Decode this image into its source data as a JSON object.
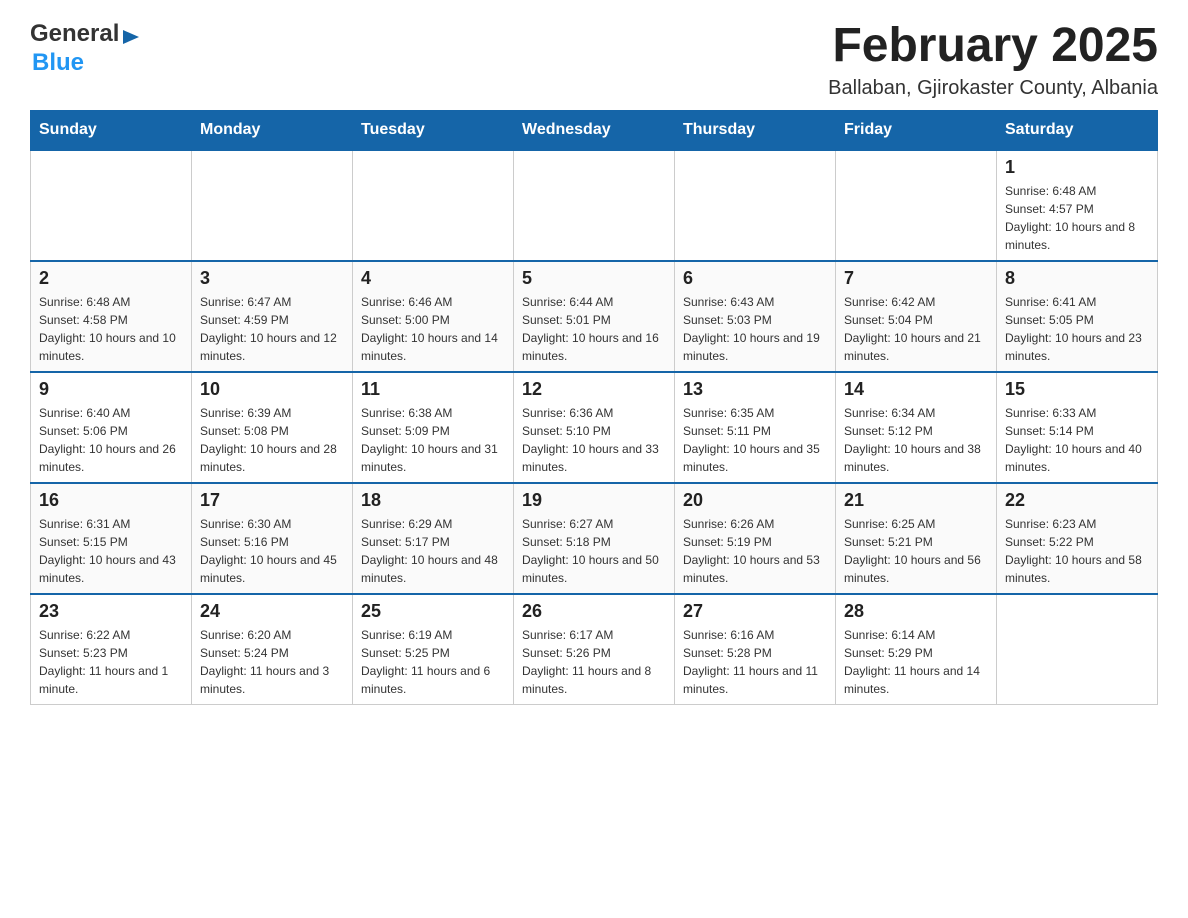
{
  "header": {
    "logo": {
      "general": "General",
      "arrow_symbol": "▶",
      "blue": "Blue"
    },
    "title": "February 2025",
    "location": "Ballaban, Gjirokaster County, Albania"
  },
  "days_of_week": [
    "Sunday",
    "Monday",
    "Tuesday",
    "Wednesday",
    "Thursday",
    "Friday",
    "Saturday"
  ],
  "weeks": [
    {
      "days": [
        {
          "date": "",
          "sunrise": "",
          "sunset": "",
          "daylight": ""
        },
        {
          "date": "",
          "sunrise": "",
          "sunset": "",
          "daylight": ""
        },
        {
          "date": "",
          "sunrise": "",
          "sunset": "",
          "daylight": ""
        },
        {
          "date": "",
          "sunrise": "",
          "sunset": "",
          "daylight": ""
        },
        {
          "date": "",
          "sunrise": "",
          "sunset": "",
          "daylight": ""
        },
        {
          "date": "",
          "sunrise": "",
          "sunset": "",
          "daylight": ""
        },
        {
          "date": "1",
          "sunrise": "Sunrise: 6:48 AM",
          "sunset": "Sunset: 4:57 PM",
          "daylight": "Daylight: 10 hours and 8 minutes."
        }
      ]
    },
    {
      "days": [
        {
          "date": "2",
          "sunrise": "Sunrise: 6:48 AM",
          "sunset": "Sunset: 4:58 PM",
          "daylight": "Daylight: 10 hours and 10 minutes."
        },
        {
          "date": "3",
          "sunrise": "Sunrise: 6:47 AM",
          "sunset": "Sunset: 4:59 PM",
          "daylight": "Daylight: 10 hours and 12 minutes."
        },
        {
          "date": "4",
          "sunrise": "Sunrise: 6:46 AM",
          "sunset": "Sunset: 5:00 PM",
          "daylight": "Daylight: 10 hours and 14 minutes."
        },
        {
          "date": "5",
          "sunrise": "Sunrise: 6:44 AM",
          "sunset": "Sunset: 5:01 PM",
          "daylight": "Daylight: 10 hours and 16 minutes."
        },
        {
          "date": "6",
          "sunrise": "Sunrise: 6:43 AM",
          "sunset": "Sunset: 5:03 PM",
          "daylight": "Daylight: 10 hours and 19 minutes."
        },
        {
          "date": "7",
          "sunrise": "Sunrise: 6:42 AM",
          "sunset": "Sunset: 5:04 PM",
          "daylight": "Daylight: 10 hours and 21 minutes."
        },
        {
          "date": "8",
          "sunrise": "Sunrise: 6:41 AM",
          "sunset": "Sunset: 5:05 PM",
          "daylight": "Daylight: 10 hours and 23 minutes."
        }
      ]
    },
    {
      "days": [
        {
          "date": "9",
          "sunrise": "Sunrise: 6:40 AM",
          "sunset": "Sunset: 5:06 PM",
          "daylight": "Daylight: 10 hours and 26 minutes."
        },
        {
          "date": "10",
          "sunrise": "Sunrise: 6:39 AM",
          "sunset": "Sunset: 5:08 PM",
          "daylight": "Daylight: 10 hours and 28 minutes."
        },
        {
          "date": "11",
          "sunrise": "Sunrise: 6:38 AM",
          "sunset": "Sunset: 5:09 PM",
          "daylight": "Daylight: 10 hours and 31 minutes."
        },
        {
          "date": "12",
          "sunrise": "Sunrise: 6:36 AM",
          "sunset": "Sunset: 5:10 PM",
          "daylight": "Daylight: 10 hours and 33 minutes."
        },
        {
          "date": "13",
          "sunrise": "Sunrise: 6:35 AM",
          "sunset": "Sunset: 5:11 PM",
          "daylight": "Daylight: 10 hours and 35 minutes."
        },
        {
          "date": "14",
          "sunrise": "Sunrise: 6:34 AM",
          "sunset": "Sunset: 5:12 PM",
          "daylight": "Daylight: 10 hours and 38 minutes."
        },
        {
          "date": "15",
          "sunrise": "Sunrise: 6:33 AM",
          "sunset": "Sunset: 5:14 PM",
          "daylight": "Daylight: 10 hours and 40 minutes."
        }
      ]
    },
    {
      "days": [
        {
          "date": "16",
          "sunrise": "Sunrise: 6:31 AM",
          "sunset": "Sunset: 5:15 PM",
          "daylight": "Daylight: 10 hours and 43 minutes."
        },
        {
          "date": "17",
          "sunrise": "Sunrise: 6:30 AM",
          "sunset": "Sunset: 5:16 PM",
          "daylight": "Daylight: 10 hours and 45 minutes."
        },
        {
          "date": "18",
          "sunrise": "Sunrise: 6:29 AM",
          "sunset": "Sunset: 5:17 PM",
          "daylight": "Daylight: 10 hours and 48 minutes."
        },
        {
          "date": "19",
          "sunrise": "Sunrise: 6:27 AM",
          "sunset": "Sunset: 5:18 PM",
          "daylight": "Daylight: 10 hours and 50 minutes."
        },
        {
          "date": "20",
          "sunrise": "Sunrise: 6:26 AM",
          "sunset": "Sunset: 5:19 PM",
          "daylight": "Daylight: 10 hours and 53 minutes."
        },
        {
          "date": "21",
          "sunrise": "Sunrise: 6:25 AM",
          "sunset": "Sunset: 5:21 PM",
          "daylight": "Daylight: 10 hours and 56 minutes."
        },
        {
          "date": "22",
          "sunrise": "Sunrise: 6:23 AM",
          "sunset": "Sunset: 5:22 PM",
          "daylight": "Daylight: 10 hours and 58 minutes."
        }
      ]
    },
    {
      "days": [
        {
          "date": "23",
          "sunrise": "Sunrise: 6:22 AM",
          "sunset": "Sunset: 5:23 PM",
          "daylight": "Daylight: 11 hours and 1 minute."
        },
        {
          "date": "24",
          "sunrise": "Sunrise: 6:20 AM",
          "sunset": "Sunset: 5:24 PM",
          "daylight": "Daylight: 11 hours and 3 minutes."
        },
        {
          "date": "25",
          "sunrise": "Sunrise: 6:19 AM",
          "sunset": "Sunset: 5:25 PM",
          "daylight": "Daylight: 11 hours and 6 minutes."
        },
        {
          "date": "26",
          "sunrise": "Sunrise: 6:17 AM",
          "sunset": "Sunset: 5:26 PM",
          "daylight": "Daylight: 11 hours and 8 minutes."
        },
        {
          "date": "27",
          "sunrise": "Sunrise: 6:16 AM",
          "sunset": "Sunset: 5:28 PM",
          "daylight": "Daylight: 11 hours and 11 minutes."
        },
        {
          "date": "28",
          "sunrise": "Sunrise: 6:14 AM",
          "sunset": "Sunset: 5:29 PM",
          "daylight": "Daylight: 11 hours and 14 minutes."
        },
        {
          "date": "",
          "sunrise": "",
          "sunset": "",
          "daylight": ""
        }
      ]
    }
  ]
}
